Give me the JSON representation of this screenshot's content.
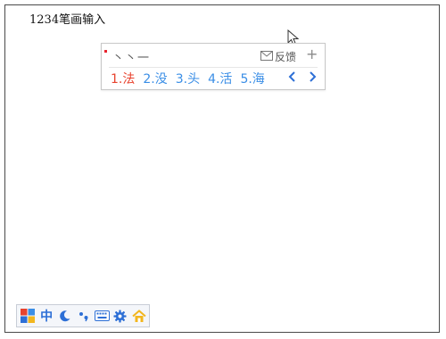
{
  "document": {
    "typed_text": "1234笔画输入"
  },
  "ime": {
    "strokes": "丶丶一",
    "feedback_label": "反馈",
    "add_symbol": "+",
    "candidates": [
      {
        "label": "1.法",
        "active": true
      },
      {
        "label": "2.没",
        "active": false
      },
      {
        "label": "3.头",
        "active": false
      },
      {
        "label": "4.活",
        "active": false
      },
      {
        "label": "5.海",
        "active": false
      }
    ],
    "icons": {
      "feedback": "mail-icon",
      "prev": "chevron-left-icon",
      "next": "chevron-right-icon"
    },
    "colors": {
      "active": "#e8432e",
      "candidate": "#3a8ee6"
    }
  },
  "toolbar": {
    "mode_label": "中",
    "icons": [
      "logo-icon",
      "mode-icon",
      "moon-icon",
      "punctuation-icon",
      "keyboard-icon",
      "gear-icon",
      "home-icon"
    ]
  }
}
